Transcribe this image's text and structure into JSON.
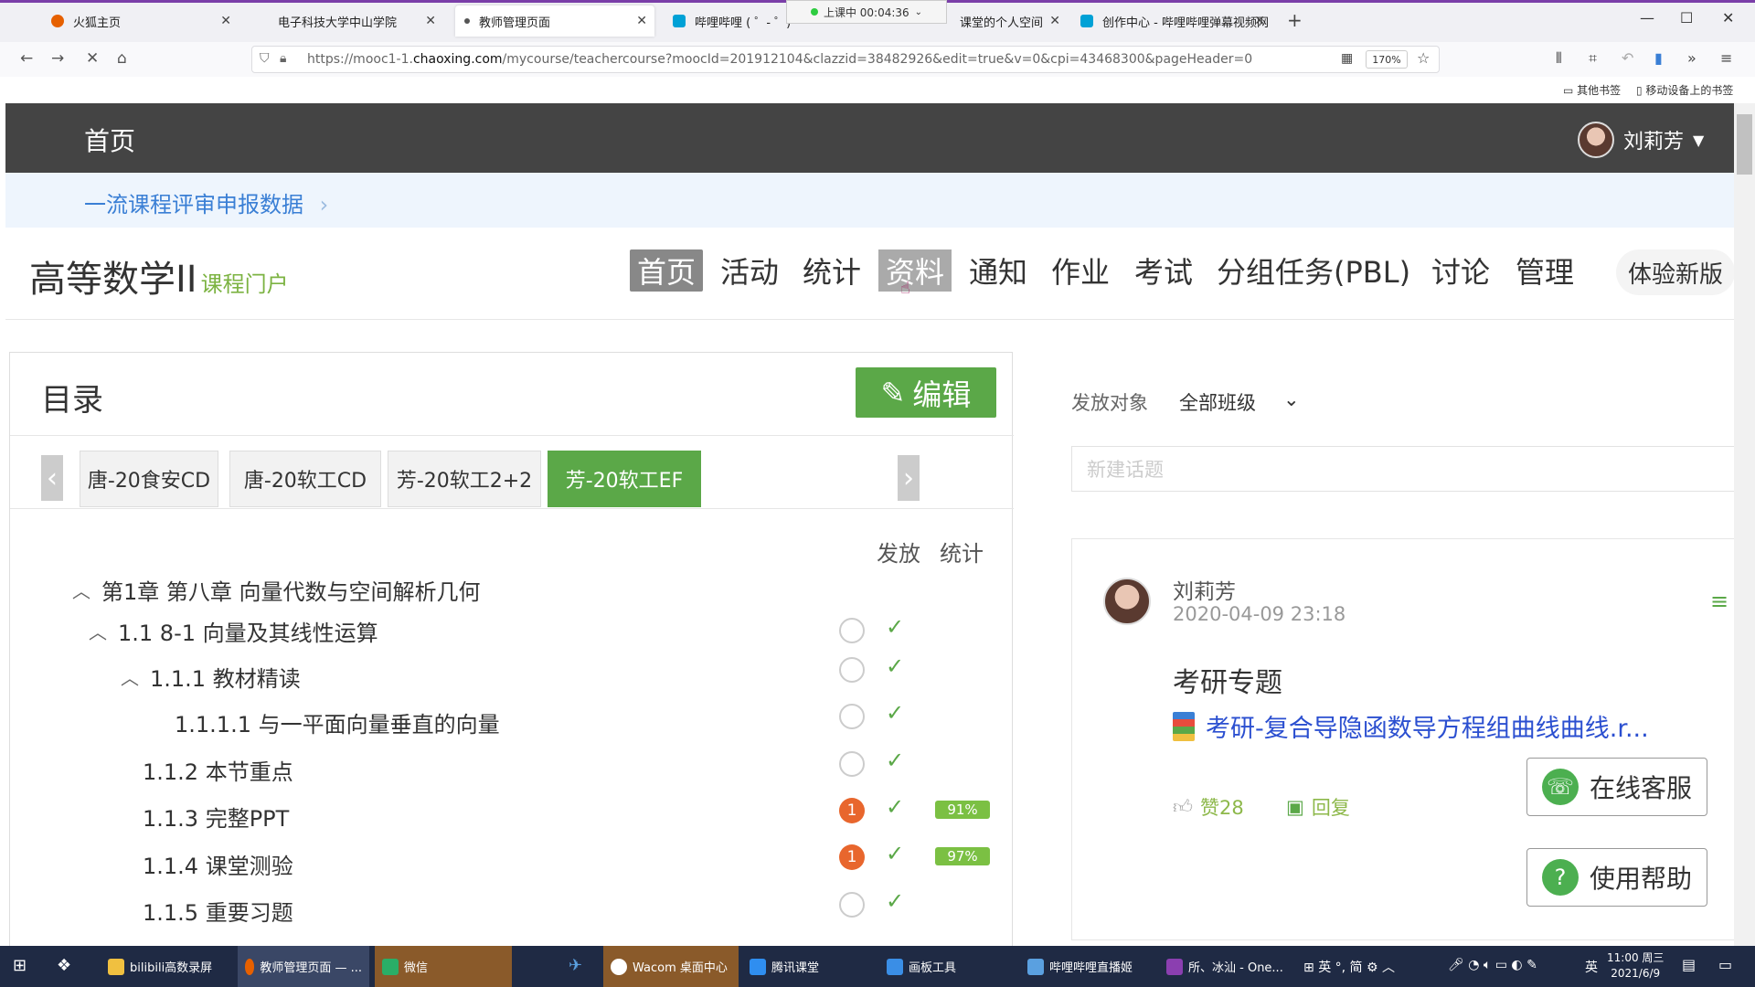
{
  "browser": {
    "tabs": [
      {
        "title": "火狐主页",
        "icon_color": "#e66000"
      },
      {
        "title": "电子科技大学中山学院",
        "icon_color": ""
      },
      {
        "title": "教师管理页面",
        "icon_color": "#555555"
      },
      {
        "title": "哔哩哔哩 ( ゜- ゜)つロ",
        "icon_color": "#00a1d6"
      },
      {
        "title": "课堂的个人空间",
        "icon_color": ""
      },
      {
        "title": "创作中心 - 哔哩哔哩弹幕视频网",
        "icon_color": "#00a1d6"
      }
    ],
    "timer": "上课中 00:04:36",
    "url_prefix": "https://mooc1-1.",
    "url_domain": "chaoxing.com",
    "url_rest": "/mycourse/teachercourse?moocId=201912104&clazzid=38482926&edit=true&v=0&cpi=43468300&pageHeader=0",
    "zoom": "170%",
    "bookmark_other": "其他书签",
    "bookmark_mobile": "移动设备上的书签"
  },
  "page": {
    "top_home": "首页",
    "user_name": "刘莉芳",
    "banner_link": "一流课程评审申报数据",
    "course_title": "高等数学II",
    "course_portal": "课程门户",
    "nav": [
      "首页",
      "活动",
      "统计",
      "资料",
      "通知",
      "作业",
      "考试",
      "分组任务(PBL)",
      "讨论",
      "管理"
    ],
    "new_version": "体验新版"
  },
  "catalog": {
    "title": "目录",
    "edit_label": "编辑",
    "class_tabs": [
      "唐-20食安CD",
      "唐-20软工CD",
      "芳-20软工2+2",
      "芳-20软工EF"
    ],
    "col_publish": "发放",
    "col_stats": "统计",
    "chapter": "第1章 第八章 向量代数与空间解析几何",
    "rows": [
      {
        "label": "1.1   8-1 向量及其线性运算",
        "badge": "",
        "pct": ""
      },
      {
        "label": "1.1.1 教材精读",
        "badge": "",
        "pct": ""
      },
      {
        "label": "1.1.1.1 与一平面向量垂直的向量",
        "badge": "",
        "pct": ""
      },
      {
        "label": "1.1.2 本节重点",
        "badge": "",
        "pct": ""
      },
      {
        "label": "1.1.3 完整PPT",
        "badge": "1",
        "pct": "91%"
      },
      {
        "label": "1.1.4 课堂测验",
        "badge": "1",
        "pct": "97%"
      },
      {
        "label": "1.1.5 重要习题",
        "badge": "",
        "pct": ""
      }
    ]
  },
  "discussion": {
    "target_label": "发放对象",
    "target_value": "全部班级",
    "new_topic_placeholder": "新建话题",
    "post": {
      "author": "刘莉芳",
      "date": "2020-04-09 23:18",
      "title": "考研专题",
      "file": "考研-复合导隐函数导方程组曲线曲线.r...",
      "likes": "赞28",
      "reply": "回复"
    },
    "online_service": "在线客服",
    "help": "使用帮助"
  },
  "taskbar": {
    "items": [
      {
        "label": "bilibili高数录屏",
        "icon_color": "#f0c040"
      },
      {
        "label": "教师管理页面 — ...",
        "icon_color": "#e66000"
      },
      {
        "label": "微信",
        "icon_color": "#2aae67"
      },
      {
        "label": "Wacom 桌面中心",
        "icon_color": "#ffffff"
      },
      {
        "label": "腾讯课堂",
        "icon_color": "#2f8ef0"
      },
      {
        "label": "画板工具",
        "icon_color": "#3a8ee6"
      },
      {
        "label": "哔哩哔哩直播姬",
        "icon_color": "#5aa0e0"
      },
      {
        "label": "所、冰汕 - One...",
        "icon_color": "#8b3fb0"
      }
    ],
    "ime": "英 °, 简",
    "lang": "英",
    "time": "11:00 周三",
    "date": "2021/6/9"
  }
}
